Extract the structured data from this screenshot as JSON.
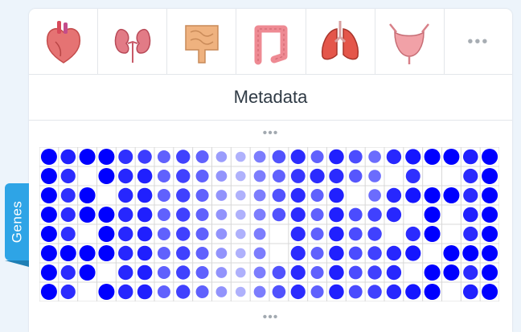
{
  "organs": [
    {
      "name": "heart-icon",
      "color": "#e57373"
    },
    {
      "name": "kidneys-icon",
      "color": "#e27b86"
    },
    {
      "name": "small-intestine-icon",
      "color": "#efb27f"
    },
    {
      "name": "large-intestine-icon",
      "color": "#ee8a93"
    },
    {
      "name": "lungs-icon",
      "color": "#e4564a"
    },
    {
      "name": "bladder-icon",
      "color": "#f1a1a7"
    }
  ],
  "organ_more_label": "•••",
  "metadata_label": "Metadata",
  "top_more_label": "•••",
  "bottom_more_label": "•••",
  "genes_label": "Genes",
  "colors": {
    "accent": "#2ea4e6",
    "dot_strong": "#0000ff",
    "dot_weak": "#d6d8fb",
    "grid_line": "#d8d8d8"
  },
  "heatmap": {
    "columns": 24,
    "rows": 8,
    "levels": [
      [
        1.0,
        0.85,
        1.0,
        1.0,
        0.78,
        0.72,
        0.55,
        0.7,
        0.55,
        0.28,
        0.18,
        0.42,
        0.62,
        0.8,
        0.55,
        0.85,
        0.65,
        0.5,
        0.82,
        0.9,
        1.0,
        1.0,
        0.85,
        1.0
      ],
      [
        1.0,
        0.8,
        null,
        1.0,
        0.82,
        0.85,
        0.55,
        0.7,
        0.55,
        0.32,
        0.18,
        0.42,
        0.55,
        0.75,
        0.8,
        0.8,
        0.6,
        0.5,
        null,
        0.78,
        null,
        null,
        0.8,
        1.0
      ],
      [
        1.0,
        0.78,
        1.0,
        null,
        0.82,
        0.85,
        0.55,
        0.7,
        0.55,
        0.32,
        0.18,
        0.42,
        0.62,
        0.8,
        0.55,
        0.85,
        null,
        0.5,
        0.82,
        0.9,
        1.0,
        1.0,
        0.8,
        1.0
      ],
      [
        1.0,
        0.8,
        1.0,
        1.0,
        0.82,
        0.85,
        0.55,
        0.7,
        0.55,
        0.32,
        0.18,
        0.42,
        0.62,
        0.8,
        0.55,
        0.85,
        0.65,
        0.7,
        0.82,
        null,
        1.0,
        null,
        0.85,
        1.0
      ],
      [
        1.0,
        0.78,
        null,
        1.0,
        0.82,
        0.85,
        0.55,
        0.7,
        0.55,
        0.32,
        0.18,
        0.42,
        null,
        0.8,
        0.55,
        0.85,
        0.65,
        0.7,
        null,
        0.8,
        1.0,
        null,
        0.8,
        1.0
      ],
      [
        1.0,
        1.0,
        1.0,
        1.0,
        0.82,
        0.85,
        0.55,
        0.7,
        0.55,
        0.32,
        0.18,
        0.42,
        null,
        0.8,
        0.55,
        0.85,
        0.65,
        0.7,
        0.82,
        0.9,
        null,
        1.0,
        1.0,
        1.0
      ],
      [
        1.0,
        0.8,
        1.0,
        null,
        0.82,
        0.85,
        0.55,
        0.7,
        0.55,
        0.32,
        0.18,
        0.42,
        0.62,
        0.8,
        0.55,
        0.85,
        0.65,
        0.7,
        0.82,
        null,
        1.0,
        1.0,
        0.8,
        1.0
      ],
      [
        1.0,
        0.8,
        null,
        1.0,
        0.82,
        0.85,
        0.55,
        0.7,
        0.55,
        0.32,
        0.18,
        0.42,
        0.62,
        0.8,
        0.55,
        0.85,
        0.65,
        0.7,
        0.82,
        0.9,
        1.0,
        null,
        0.85,
        1.0
      ]
    ]
  }
}
